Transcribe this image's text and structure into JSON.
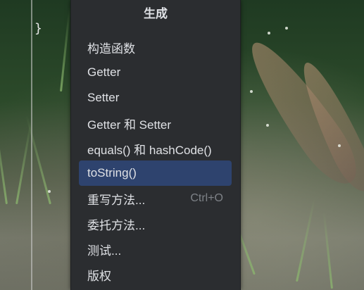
{
  "editor": {
    "code_line": "}"
  },
  "popup": {
    "title": "生成",
    "items": [
      {
        "label": "构造函数",
        "shortcut": ""
      },
      {
        "label": "Getter",
        "shortcut": ""
      },
      {
        "label": "Setter",
        "shortcut": ""
      },
      {
        "label": "Getter 和 Setter",
        "shortcut": ""
      },
      {
        "label": "equals() 和 hashCode()",
        "shortcut": ""
      },
      {
        "label": "toString()",
        "shortcut": "",
        "selected": true
      },
      {
        "label": "重写方法...",
        "shortcut": "Ctrl+O"
      },
      {
        "label": "委托方法...",
        "shortcut": ""
      },
      {
        "label": "测试...",
        "shortcut": ""
      },
      {
        "label": "版权",
        "shortcut": ""
      }
    ]
  },
  "colors": {
    "popup_background": "#2b2d30",
    "selection": "#2e436e",
    "text": "#dfe1e5",
    "shortcut_text": "#7e8287"
  }
}
